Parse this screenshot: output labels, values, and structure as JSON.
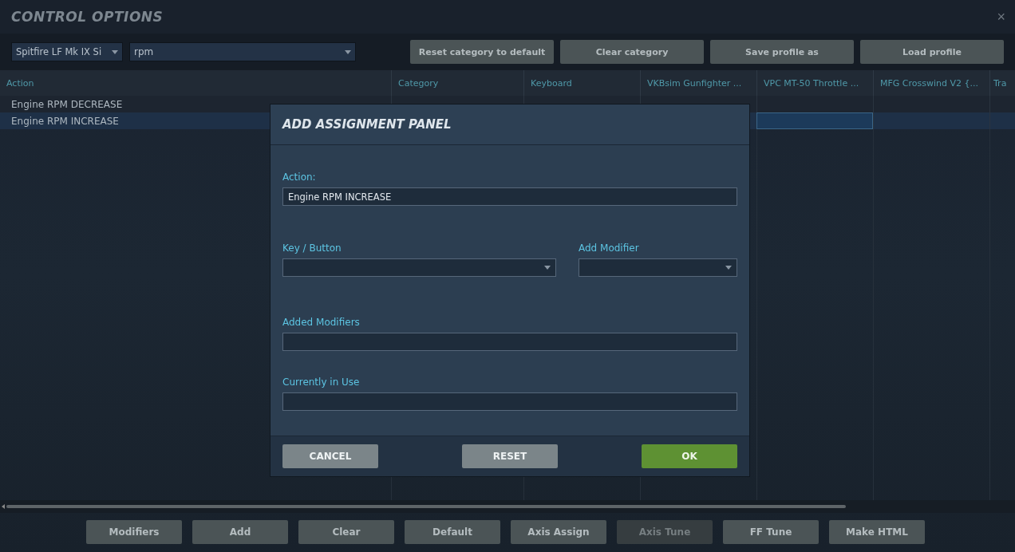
{
  "window": {
    "title": "CONTROL OPTIONS",
    "close": "×"
  },
  "toolbar": {
    "aircraft": {
      "value": "Spitfire LF Mk IX Si"
    },
    "filter": {
      "value": "rpm"
    },
    "buttons": [
      {
        "label": "Reset category to default",
        "disabled": false
      },
      {
        "label": "Clear category",
        "disabled": false
      },
      {
        "label": "Save profile as",
        "disabled": false
      },
      {
        "label": "Load profile",
        "disabled": false
      }
    ]
  },
  "table": {
    "columns": [
      "Action",
      "Category",
      "Keyboard",
      "VKBsim Gunfighter ...",
      "VPC MT-50 Throttle ...",
      "MFG Crosswind V2 {...",
      "Tra"
    ],
    "rows": [
      {
        "cells": [
          "Engine RPM DECREASE",
          "",
          "",
          "",
          "",
          "",
          ""
        ],
        "selected": false
      },
      {
        "cells": [
          "Engine RPM INCREASE",
          "",
          "",
          "",
          "",
          "",
          ""
        ],
        "selected": true
      }
    ]
  },
  "dialog": {
    "title": "ADD ASSIGNMENT PANEL",
    "action": {
      "label": "Action:",
      "value": "Engine RPM INCREASE"
    },
    "key_button": {
      "label": "Key / Button"
    },
    "add_modifier": {
      "label": "Add Modifier"
    },
    "added_modifiers": {
      "label": "Added Modifiers"
    },
    "currently_in_use": {
      "label": "Currently in Use"
    },
    "buttons": [
      {
        "label": "CANCEL",
        "kind": "neutral"
      },
      {
        "label": "RESET",
        "kind": "neutral"
      },
      {
        "label": "OK",
        "kind": "primary"
      }
    ]
  },
  "bottom_buttons": [
    {
      "label": "Modifiers",
      "disabled": false
    },
    {
      "label": "Add",
      "disabled": false
    },
    {
      "label": "Clear",
      "disabled": false
    },
    {
      "label": "Default",
      "disabled": false
    },
    {
      "label": "Axis Assign",
      "disabled": false
    },
    {
      "label": "Axis Tune",
      "disabled": true
    },
    {
      "label": "FF Tune",
      "disabled": false
    },
    {
      "label": "Make HTML",
      "disabled": false
    }
  ]
}
